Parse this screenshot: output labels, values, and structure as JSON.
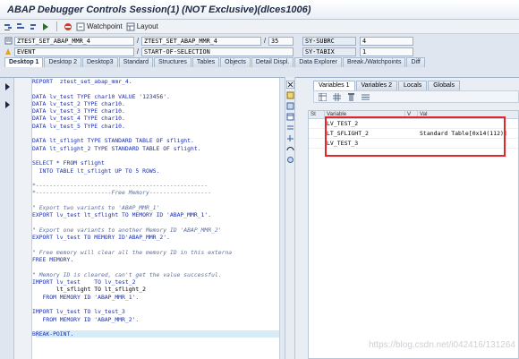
{
  "window": {
    "title": "ABAP Debugger Controls Session(1)  (NOT Exclusive)(dlces1006)"
  },
  "toolbar": {
    "watchpoint_label": "Watchpoint",
    "layout_label": "Layout"
  },
  "fields": {
    "program1": "ZTEST_SET_ABAP_MMR_4",
    "program2": "ZTEST_SET_ABAP_MMR_4",
    "line": "35",
    "subrc_label": "SY-SUBRC",
    "subrc_value": "4",
    "event_type": "EVENT",
    "event_name": "START-OF-SELECTION",
    "tabix_label": "SY-TABIX",
    "tabix_value": "1"
  },
  "desktop_tabs": [
    "Desktop 1",
    "Desktop 2",
    "Desktop3",
    "Standard",
    "Structures",
    "Tables",
    "Objects",
    "Detail Displ.",
    "Data Explorer",
    "Break./Watchpoints",
    "Diff"
  ],
  "variable_tabs": [
    "Variables 1",
    "Variables 2",
    "Locals",
    "Globals"
  ],
  "var_columns": {
    "st": "St",
    "variable": "Variable",
    "v": "V",
    "val": "Val"
  },
  "variables": [
    {
      "name": "LV_TEST_2",
      "value": ""
    },
    {
      "name": "LT_SFLIGHT_2",
      "value": "Standard Table[0x14(112)]"
    },
    {
      "name": "LV_TEST_3",
      "value": ""
    }
  ],
  "code_lines": [
    "REPORT  ztest_set_abap_mmr_4.",
    "",
    "DATA lv_test TYPE char10 VALUE '123456'.",
    "DATA lv_test_2 TYPE char10.",
    "DATA lv_test_3 TYPE char10.",
    "DATA lv_test_4 TYPE char10.",
    "DATA lv_test_5 TYPE char10.",
    "",
    "DATA lt_sflight TYPE STANDARD TABLE OF sflight.",
    "DATA lt_sflight_2 TYPE STANDARD TABLE OF sflight.",
    "",
    "SELECT * FROM sflight",
    "  INTO TABLE lt_sflight UP TO 5 ROWS.",
    "",
    "*--------------------------------------------------",
    "*----------------------Free Memory------------------",
    "",
    "\" Export two variants to 'ABAP_MMR_1'",
    "EXPORT lv_test lt_sflight TO MEMORY ID 'ABAP_MMR_1'.",
    "",
    "\" Export one variants to another Memory ID 'ABAP_MMR_2'",
    "EXPORT lv_test TO MEMORY ID'ABAP_MMR_2'.",
    "",
    "\" Free memory will clear all the memory ID in this externa",
    "FREE MEMORY.",
    "",
    "\" Memory ID is cleared, can't get the value successful.",
    "IMPORT lv_test    TO lv_test_2",
    "       lt_sflight TO lt_sflight_2",
    "   FROM MEMORY ID 'ABAP_MMR_1'.",
    "",
    "IMPORT lv_test TO lv_test_3",
    "   FROM MEMORY ID 'ABAP_MMR_2'.",
    "",
    "BREAK-POINT."
  ],
  "watermark": "https://blog.csdn.net/i042416/131264"
}
